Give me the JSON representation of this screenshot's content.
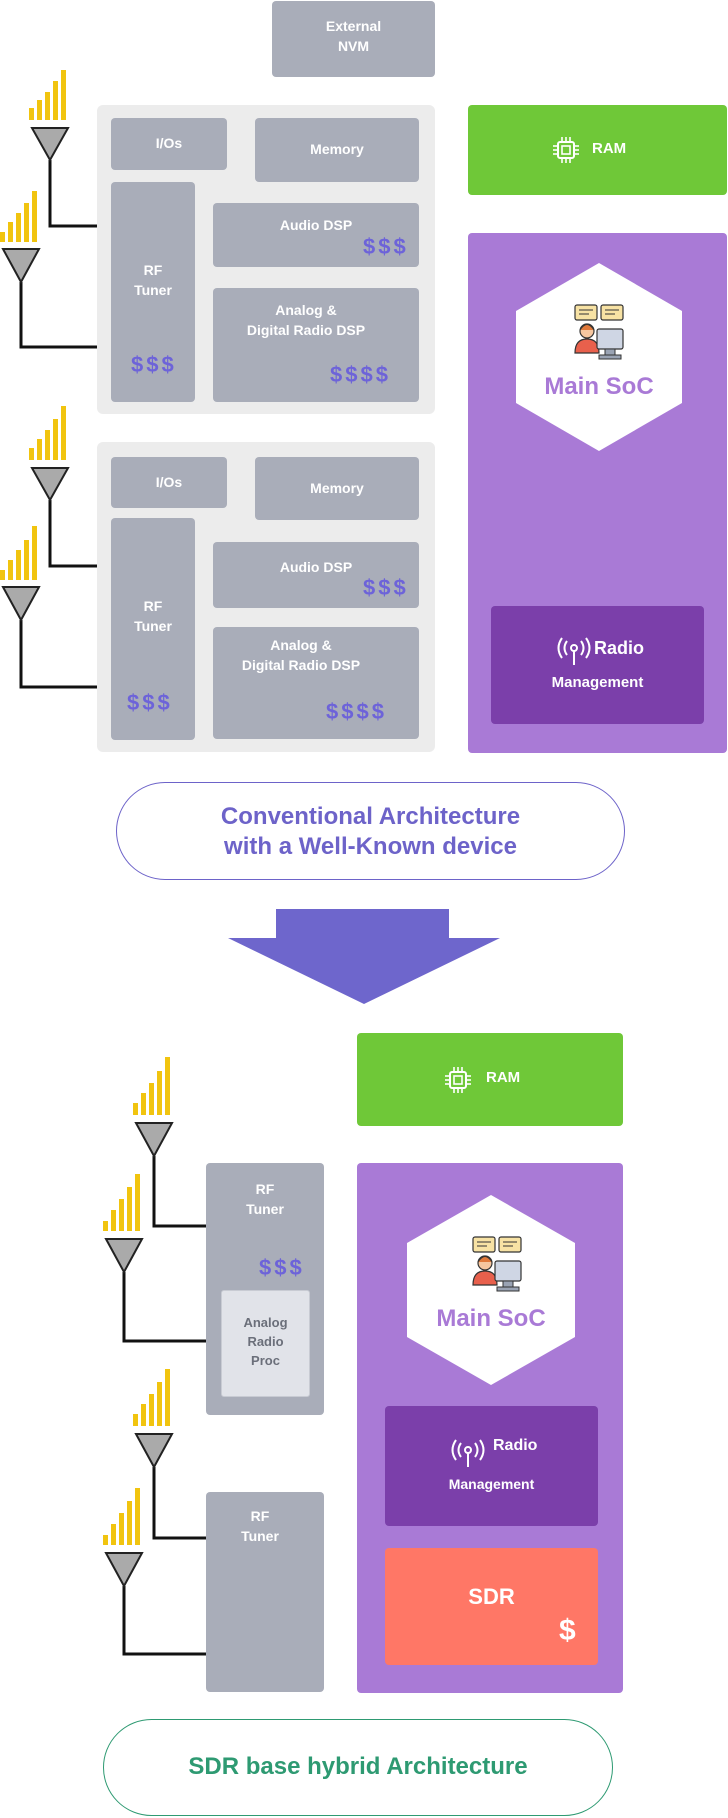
{
  "top": {
    "nvm": "External\nNVM",
    "ram": "RAM",
    "soc_title": "Main SoC",
    "radio_title": "Radio",
    "radio_sub": "Management",
    "tuner1": {
      "ios": "I/Os",
      "memory": "Memory",
      "rf": "RF\nTuner",
      "rf_cost": "$$$",
      "audio": "Audio DSP",
      "audio_cost": "$$$",
      "analog": "Analog &\nDigital Radio DSP",
      "analog_cost": "$$$$"
    },
    "tuner2": {
      "ios": "I/Os",
      "memory": "Memory",
      "rf": "RF\nTuner",
      "rf_cost": "$$$",
      "audio": "Audio DSP",
      "audio_cost": "$$$",
      "analog": "Analog &\nDigital Radio DSP",
      "analog_cost": "$$$$"
    },
    "caption": "Conventional Architecture\nwith a Well-Known device",
    "caption_color": "#6d63c9"
  },
  "bottom": {
    "ram": "RAM",
    "soc_title": "Main SoC",
    "radio_title": "Radio",
    "radio_sub": "Management",
    "sdr": "SDR",
    "sdr_cost": "$",
    "tuner1": {
      "rf": "RF\nTuner",
      "rf_cost": "$$$",
      "proc": "Analog\nRadio\nProc"
    },
    "tuner2": {
      "rf": "RF\nTuner"
    },
    "caption": "SDR base hybrid Architecture",
    "caption_color": "#2e9a72"
  },
  "colors": {
    "accent_purple": "#a97ad6",
    "dark_purple": "#7b3faa",
    "ram_green": "#6fc838",
    "sdr_red": "#ff7766",
    "arrow": "#6e66cc",
    "signal": "#f1c40f"
  },
  "icons": [
    "chip-icon",
    "antenna-icon",
    "signal-bars-icon",
    "developer-icon",
    "radio-waves-icon",
    "down-arrow-icon"
  ]
}
